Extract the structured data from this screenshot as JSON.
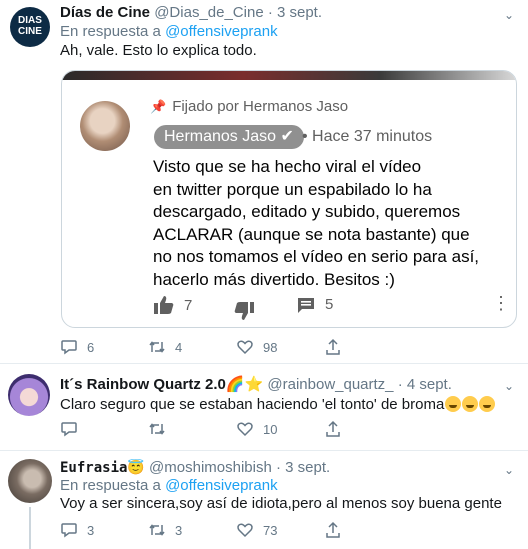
{
  "tweets": [
    {
      "name": "Días de Cine",
      "handle": "@Dias_de_Cine",
      "date": "· 3 sept.",
      "reply_prefix": "En respuesta a",
      "reply_to": "@offensiveprank",
      "text": "Ah, vale. Esto lo explica todo.",
      "avatar_text": [
        "DIAS",
        "CINE"
      ],
      "replies": "6",
      "retweets": "4",
      "likes": "98",
      "embed": {
        "pinned": "Fijado por Hermanos Jaso",
        "channel": "Hermanos Jaso ✔",
        "time": "• Hace 37 minutos",
        "lines": [
          "Visto que se ha hecho viral el vídeo",
          "en twitter porque un espabilado lo ha",
          "descargado, editado y subido, queremos",
          "ACLARAR (aunque se nota bastante) que",
          "no nos tomamos el vídeo en serio para así,",
          "hacerlo más divertido. Besitos :)"
        ],
        "likes": "7",
        "comments": "5"
      }
    },
    {
      "name": "It´s Rainbow Quartz 2.0🌈⭐",
      "handle": "@rainbow_quartz_",
      "date": "· 4 sept.",
      "text": "Claro seguro que se estaban haciendo 'el tonto' de broma",
      "replies": "",
      "retweets": "",
      "likes": "10"
    },
    {
      "name": "Eufrasia😇",
      "handle": "@moshimoshibish",
      "date": "· 3 sept.",
      "reply_prefix": "En respuesta a",
      "reply_to": "@offensiveprank",
      "text": "Voy a ser sincera,soy así de idiota,pero al menos soy buena gente",
      "replies": "3",
      "retweets": "3",
      "likes": "73"
    }
  ],
  "colors": {
    "link": "#1da1f2",
    "muted": "#657786",
    "border": "#e6ecf0"
  }
}
